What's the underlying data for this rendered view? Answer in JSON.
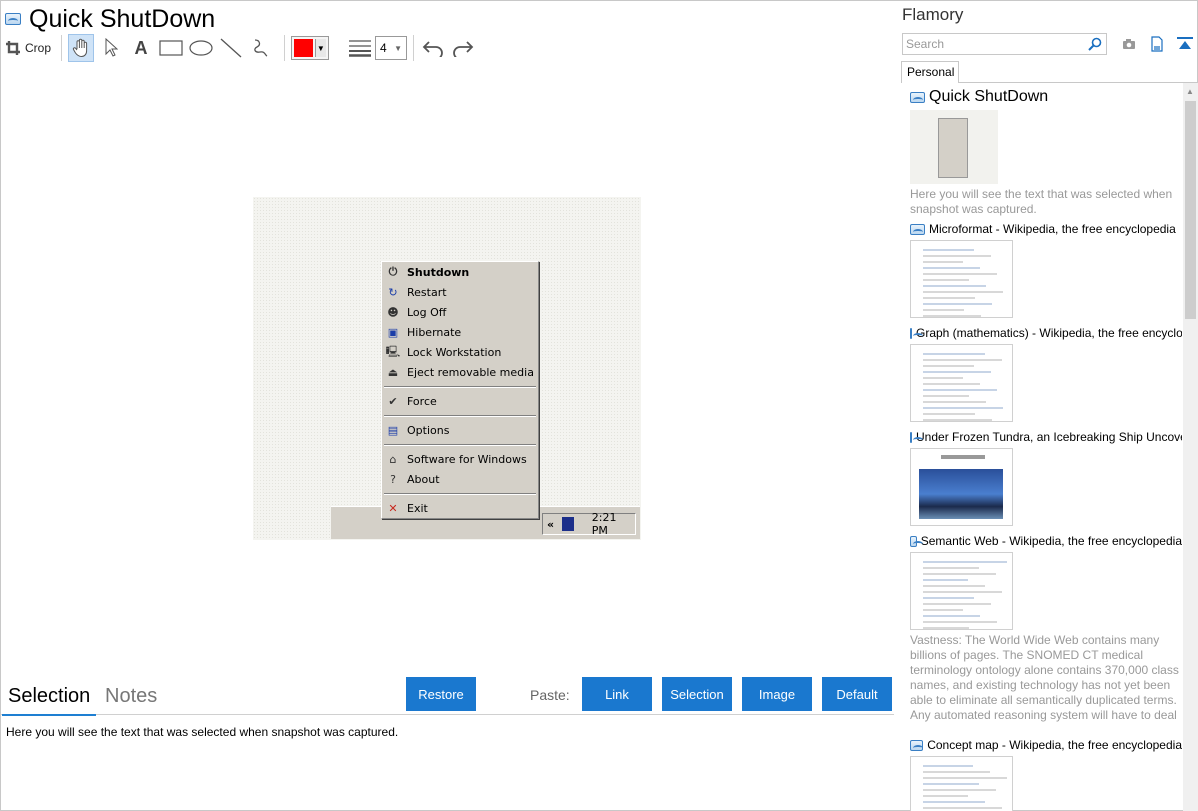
{
  "window": {
    "title": "Quick ShutDown"
  },
  "toolbar": {
    "crop_label": "Crop",
    "color": "#ff0000",
    "line_width": "4"
  },
  "snapshot": {
    "menu_items": [
      {
        "label": "Shutdown",
        "icon": "shutdown-icon",
        "bold": true
      },
      {
        "label": "Restart",
        "icon": "restart-icon"
      },
      {
        "label": "Log Off",
        "icon": "logoff-icon"
      },
      {
        "label": "Hibernate",
        "icon": "hibernate-icon"
      },
      {
        "label": "Lock Workstation",
        "icon": "lock-workstation-icon"
      },
      {
        "label": "Eject removable media",
        "icon": "eject-icon"
      },
      {
        "label": "Force",
        "icon": "check-icon"
      },
      {
        "label": "Options",
        "icon": "options-icon"
      },
      {
        "label": "Software for Windows",
        "icon": "home-icon"
      },
      {
        "label": "About",
        "icon": "help-icon"
      },
      {
        "label": "Exit",
        "icon": "close-icon"
      }
    ],
    "tray": {
      "chevron": "«",
      "clock": "2:21 PM"
    }
  },
  "bottom": {
    "tab_selection": "Selection",
    "tab_notes": "Notes",
    "restore_label": "Restore",
    "paste_label": "Paste:",
    "paste_link": "Link",
    "paste_selection": "Selection",
    "paste_image": "Image",
    "paste_default": "Default",
    "selection_text": "Here you will see the text that was selected when snapshot was captured."
  },
  "sidebar": {
    "title": "Flamory",
    "search_placeholder": "Search",
    "tab_personal": "Personal",
    "items": [
      {
        "title": "Quick ShutDown",
        "desc": "Here you will see the text that was selected when snapshot was captured."
      },
      {
        "title": "Microformat - Wikipedia, the free encyclopedia",
        "desc": ""
      },
      {
        "title": "Graph (mathematics) - Wikipedia, the free encyclopedia",
        "desc": ""
      },
      {
        "title": "Under Frozen Tundra, an Icebreaking Ship Uncovers",
        "desc": ""
      },
      {
        "title": "Semantic Web - Wikipedia, the free encyclopedia",
        "desc": "Vastness: The World Wide Web contains many billions of pages. The SNOMED CT medical terminology ontology alone contains 370,000 class names, and existing technology has not yet been able to eliminate all semantically duplicated terms. Any automated reasoning system will have to deal with truly huge inputs."
      },
      {
        "title": "Concept map - Wikipedia, the free encyclopedia",
        "desc": ""
      }
    ]
  }
}
